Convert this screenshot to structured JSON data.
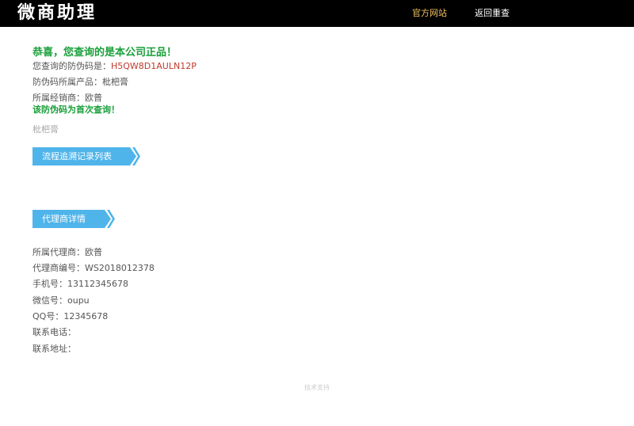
{
  "header": {
    "logo": "微商助理",
    "nav_official": "官方网站",
    "nav_recheck": "返回重查"
  },
  "result": {
    "congrats": "恭喜，您查询的是本公司正品！",
    "code_label": "您查询的防伪码是：",
    "code_value": "H5QW8D1AULN12P",
    "product_line": "防伪码所属产品：枇杷膏",
    "dealer_line": "所属经销商：欧普",
    "first_query": "该防伪码为首次查询！",
    "product_name": "枇杷膏"
  },
  "sections": {
    "trace_title": "流程追溯记录列表",
    "agent_title": "代理商详情"
  },
  "agent": {
    "lines": [
      "所属代理商：欧普",
      "代理商编号：WS2018012378",
      "手机号：13112345678",
      "微信号：oupu",
      "QQ号：12345678",
      "联系电话：",
      "联系地址："
    ]
  },
  "footer": {
    "text": "技术支持"
  },
  "colors": {
    "accent": "#4fb4ea",
    "success": "#1a9f3a",
    "code": "#c0392b",
    "nav_highlight": "#f0c060"
  }
}
